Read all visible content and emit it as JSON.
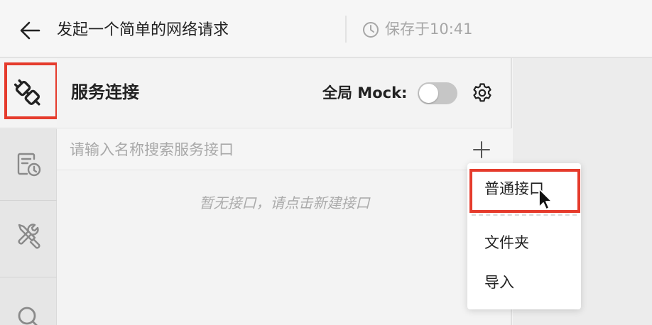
{
  "header": {
    "back_icon": "arrow-left-icon",
    "title": "发起一个简单的网络请求",
    "save_icon": "clock-icon",
    "save_status": "保存于10:41"
  },
  "rail": {
    "items": [
      {
        "icon": "plug-icon",
        "active": true
      },
      {
        "icon": "history-icon",
        "active": false
      },
      {
        "icon": "tools-icon",
        "active": false
      },
      {
        "icon": "search-icon",
        "active": false
      }
    ],
    "highlight_color": "#e53b2c"
  },
  "panel": {
    "title": "服务连接",
    "mock_label": "全局 Mock:",
    "mock_enabled": false,
    "settings_icon": "gear-icon",
    "search": {
      "placeholder": "请输入名称搜索服务接口",
      "value": ""
    },
    "add_icon": "plus-icon",
    "empty_text": "暂无接口，请点击新建接口"
  },
  "menu": {
    "items": [
      {
        "label": "普通接口",
        "highlighted": true
      },
      {
        "label": "文件夹",
        "highlighted": false
      },
      {
        "label": "导入",
        "highlighted": false
      }
    ]
  }
}
